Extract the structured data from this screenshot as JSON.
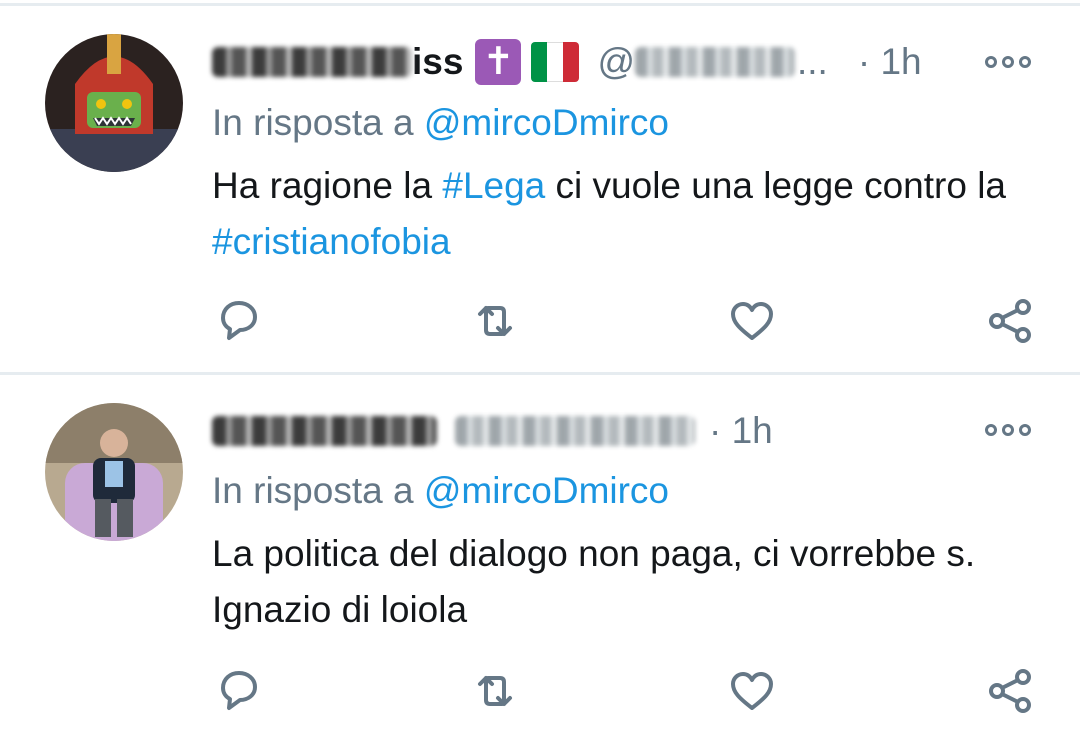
{
  "tweets": [
    {
      "name_tail": "iss",
      "handle_prefix": "@",
      "handle_suffix": "...",
      "time": "· 1h",
      "reply_prefix": "In risposta a",
      "reply_mention": "@mircoDmirco",
      "body": {
        "t1": "Ha ragione la",
        "tag1": "#Lega",
        "t2": "ci vuole una legge contro la",
        "tag2": "#cristianofobia"
      }
    },
    {
      "time": "· 1h",
      "reply_prefix": "In risposta a",
      "reply_mention": "@mircoDmirco",
      "body": {
        "t1": "La politica del dialogo non paga, ci vorrebbe s. Ignazio di loiola"
      }
    }
  ],
  "icons": [
    "reply-icon",
    "retweet-icon",
    "like-icon",
    "share-icon",
    "more-icon"
  ],
  "colors": {
    "link": "#1b95e0",
    "muted": "#657786",
    "divider": "#e6ecf0"
  }
}
